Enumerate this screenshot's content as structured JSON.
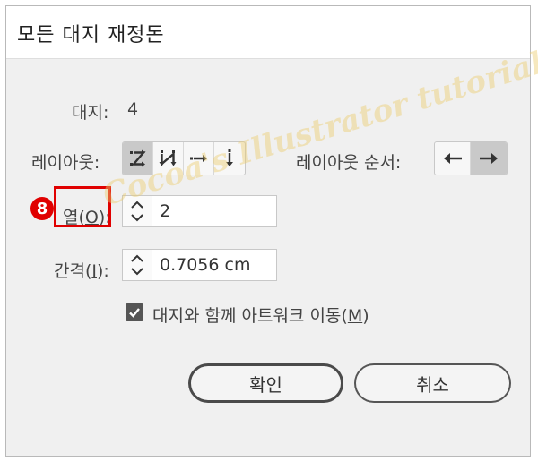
{
  "dialog": {
    "title": "모든 대지 재정돈"
  },
  "artboards": {
    "label": "대지:",
    "count": "4"
  },
  "layout": {
    "label": "레이아웃:",
    "buttons": [
      {
        "icon": "grid-by-row-icon",
        "active": true
      },
      {
        "icon": "grid-by-column-icon",
        "active": false
      },
      {
        "icon": "arrange-by-row-icon",
        "active": false
      },
      {
        "icon": "arrange-by-column-icon",
        "active": false
      }
    ]
  },
  "layout_order": {
    "label": "레이아웃 순서:",
    "buttons": [
      {
        "icon": "arrow-left-icon",
        "active": false
      },
      {
        "icon": "arrow-right-icon",
        "active": true
      }
    ]
  },
  "columns": {
    "label_prefix": "열(",
    "label_key": "O",
    "label_suffix": "):",
    "value": "2"
  },
  "spacing": {
    "label_prefix": "간격(",
    "label_key": "I",
    "label_suffix": "):",
    "value": "0.7056 cm"
  },
  "move_artwork": {
    "label_prefix": "대지와 함께 아트워크 이동(",
    "label_key": "M",
    "label_suffix": ")",
    "checked": true
  },
  "buttons": {
    "ok": "확인",
    "cancel": "취소"
  },
  "annotation": {
    "step": "8",
    "color": "#e00000"
  },
  "watermark": {
    "text": "Cocoa's Illustrator tutorials"
  }
}
